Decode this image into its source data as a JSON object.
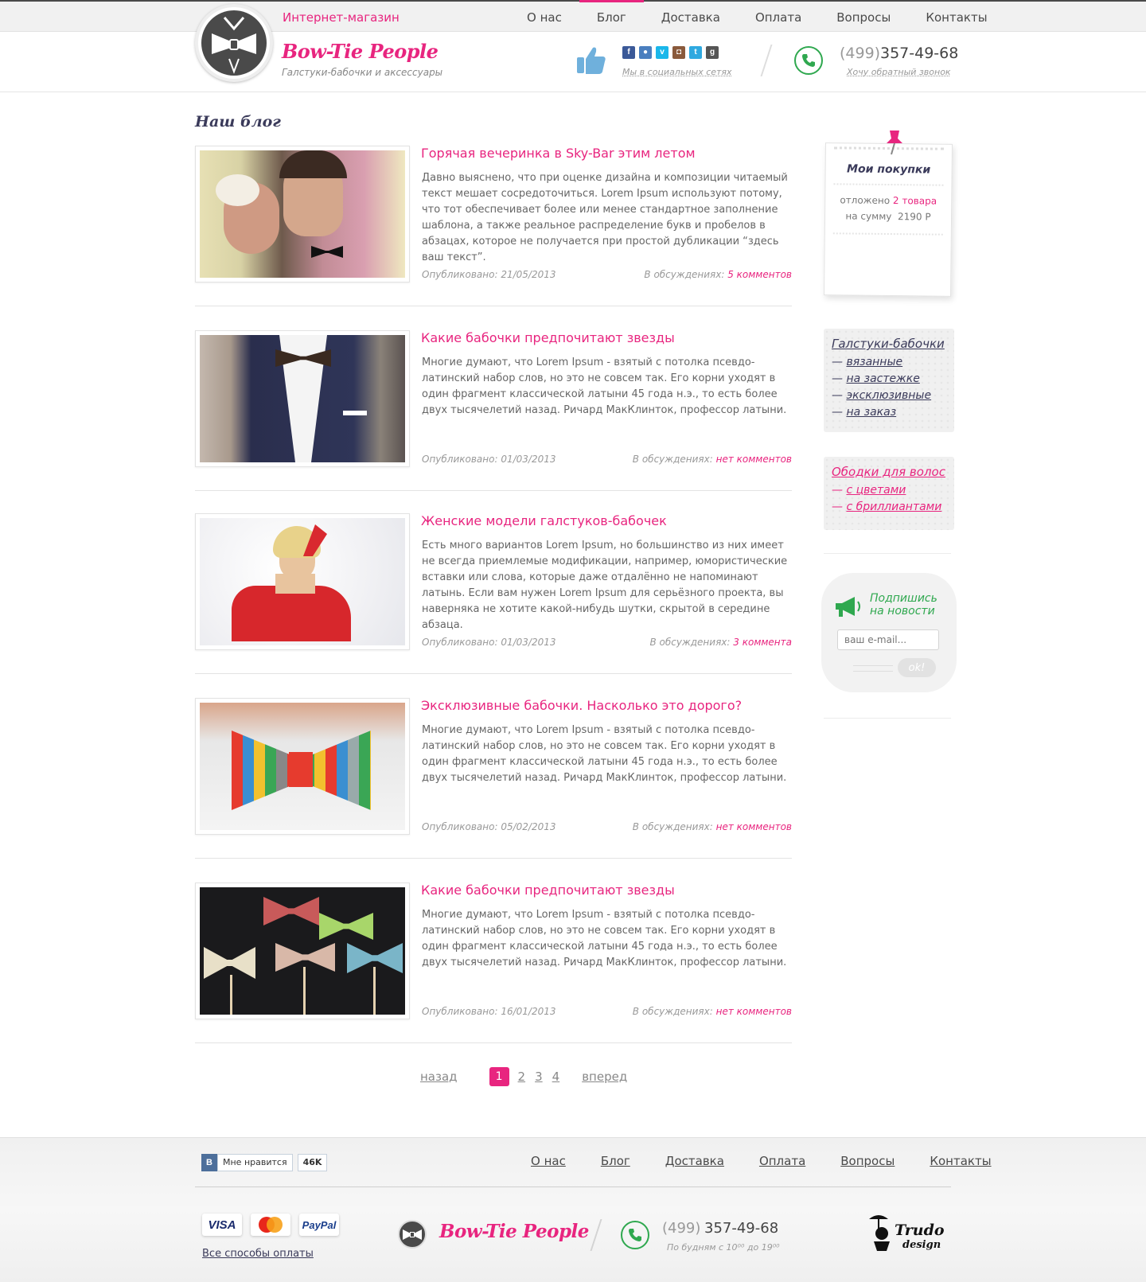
{
  "topbar": {
    "shop_label": "Интернет-магазин",
    "nav": [
      "О нас",
      "Блог",
      "Доставка",
      "Оплата",
      "Вопросы",
      "Контакты"
    ],
    "active_index": 1
  },
  "header": {
    "brand": "Bow-Tie People",
    "subtitle": "Галстуки-бабочки и аксессуары",
    "social_caption": "Мы в социальных сетях",
    "social_icons": [
      "facebook-icon",
      "flickr-icon",
      "vimeo-icon",
      "instagram-icon",
      "twitter-icon",
      "googleplus-icon"
    ],
    "phone_code": "(499)",
    "phone_number": "357-49-68",
    "callback": "Хочу обратный звонок"
  },
  "blog": {
    "title": "Наш блог",
    "posts": [
      {
        "title": "Горячая вечеринка в Sky-Bar этим летом",
        "text": "Давно выяснено, что при оценке дизайна и композиции читаемый текст мешает сосредоточиться. Lorem Ipsum используют потому, что тот обеспечивает более или менее стандартное заполнение шаблона, а также реальное распределение букв и пробелов в абзацах, которое не получается при простой дубликации “здесь ваш текст”.",
        "date_label": "Опубликовано: 21/05/2013",
        "comments_label": "В обсуждениях:",
        "comments_link": "5 комментов"
      },
      {
        "title": "Какие бабочки предпочитают звезды",
        "text": "Многие думают, что Lorem Ipsum - взятый с потолка псевдо-латинский набор слов, но это не совсем так. Его корни уходят в один фрагмент классической латыни 45 года н.э., то есть более двух тысячелетий назад. Ричард МакКлинток, профессор латыни.",
        "date_label": "Опубликовано: 01/03/2013",
        "comments_label": "В обсуждениях:",
        "comments_link": "нет комментов"
      },
      {
        "title": "Женские модели галстуков-бабочек",
        "text": "Есть много вариантов Lorem Ipsum, но большинство из них имеет не всегда приемлемые модификации, например, юмористические вставки или слова, которые даже отдалённо не напоминают латынь. Если вам нужен Lorem Ipsum для серьёзного проекта, вы наверняка не хотите какой-нибудь шутки, скрытой в середине абзаца.",
        "date_label": "Опубликовано: 01/03/2013",
        "comments_label": "В обсуждениях:",
        "comments_link": "3 коммента"
      },
      {
        "title": "Эксклюзивные бабочки. Насколько это дорого?",
        "text": "Многие думают, что Lorem Ipsum - взятый с потолка псевдо-латинский набор слов, но это не совсем так. Его корни уходят в один фрагмент классической латыни 45 года н.э., то есть более двух тысячелетий назад. Ричард МакКлинток, профессор латыни.",
        "date_label": "Опубликовано: 05/02/2013",
        "comments_label": "В обсуждениях:",
        "comments_link": "нет комментов"
      },
      {
        "title": "Какие бабочки предпочитают звезды",
        "text": "Многие думают, что Lorem Ipsum - взятый с потолка псевдо-латинский набор слов, но это не совсем так. Его корни уходят в один фрагмент классической латыни 45 года н.э., то есть более двух тысячелетий назад. Ричард МакКлинток, профессор латыни.",
        "date_label": "Опубликовано: 16/01/2013",
        "comments_label": "В обсуждениях:",
        "comments_link": "нет комментов"
      }
    ]
  },
  "pagination": {
    "back": "назад",
    "pages": [
      "1",
      "2",
      "3",
      "4"
    ],
    "current": "1",
    "next": "вперед"
  },
  "cart": {
    "title": "Мои покупки",
    "reserved_label": "отложено",
    "reserved_count": "2 товара",
    "sum_label": "на сумму",
    "sum_value": "2190 Р"
  },
  "categories": [
    {
      "title": "Галстуки-бабочки",
      "items": [
        "вязанные",
        "на застежке",
        "эксклюзивные",
        "на заказ"
      ]
    },
    {
      "title": "Ободки для волос",
      "items": [
        "с цветами",
        "с бриллиантами"
      ]
    }
  ],
  "subscribe": {
    "title_line1": "Подпишись",
    "title_line2": "на новости",
    "placeholder": "ваш e-mail...",
    "button": "ok!"
  },
  "footer": {
    "vk_like": "Мне нравится",
    "vk_count": "46K",
    "nav": [
      "О нас",
      "Блог",
      "Доставка",
      "Оплата",
      "Вопросы",
      "Контакты"
    ],
    "payments": [
      "VISA",
      "MasterCard",
      "PayPal"
    ],
    "all_payments": "Все способы оплаты",
    "brand": "Bow-Tie People",
    "phone_code": "(499)",
    "phone_number": "357-49-68",
    "hours": "По будням с 10⁰⁰ до 19⁰⁰",
    "studio": "Trudo design"
  }
}
